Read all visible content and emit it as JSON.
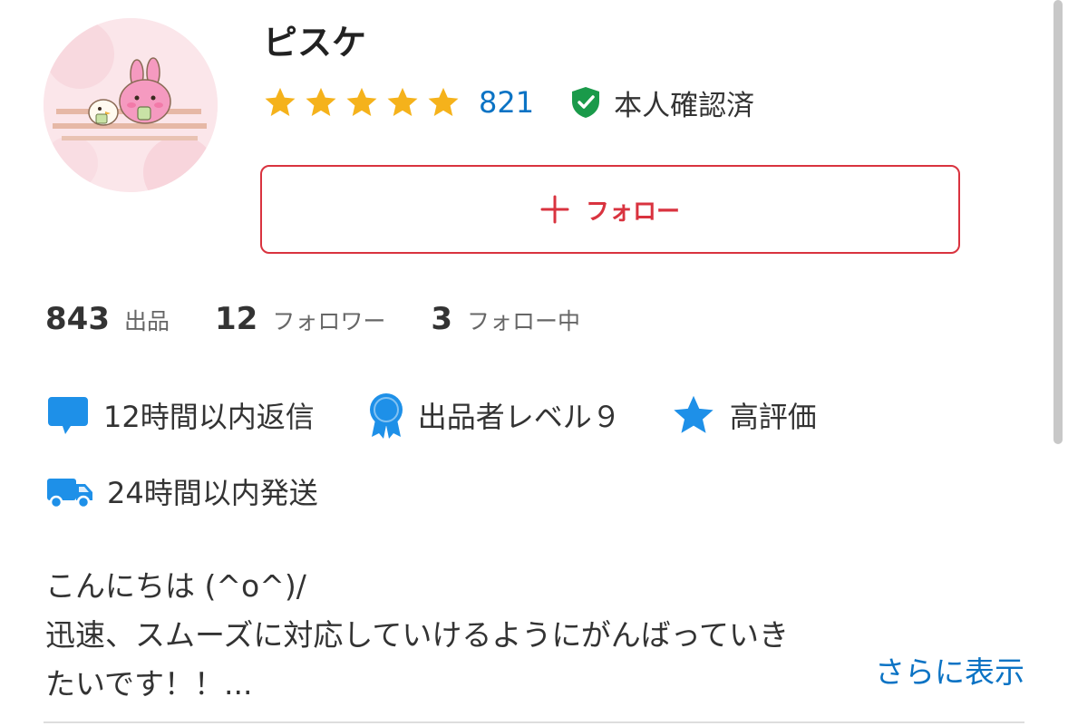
{
  "profile": {
    "name": "ピスケ",
    "rating_count": "821",
    "rating_stars": 5,
    "verified_label": "本人確認済",
    "avatar_icon": "avatar-character-illustration"
  },
  "follow_button": {
    "label": "フォロー",
    "icon": "plus-icon"
  },
  "stats": [
    {
      "value": "843",
      "label": "出品"
    },
    {
      "value": "12",
      "label": "フォロワー"
    },
    {
      "value": "3",
      "label": "フォロー中"
    }
  ],
  "badges": {
    "reply": {
      "label": "12時間以内返信",
      "icon": "chat-bubble-icon"
    },
    "level": {
      "label": "出品者レベル９",
      "icon": "medal-icon"
    },
    "rating": {
      "label": "高評価",
      "icon": "star-icon"
    },
    "shipping": {
      "label": "24時間以内発送",
      "icon": "truck-icon"
    }
  },
  "bio": {
    "text": "こんにちは (^o^)/\n迅速、スムーズに対応していけるようにがんばっていき\nたいです！！...",
    "more_label": "さらに表示"
  },
  "colors": {
    "accent_red": "#d9333f",
    "link_blue": "#0b73c4",
    "badge_blue": "#1e90e8",
    "star_gold": "#f5b21b",
    "verified_green": "#1a9a4a"
  }
}
